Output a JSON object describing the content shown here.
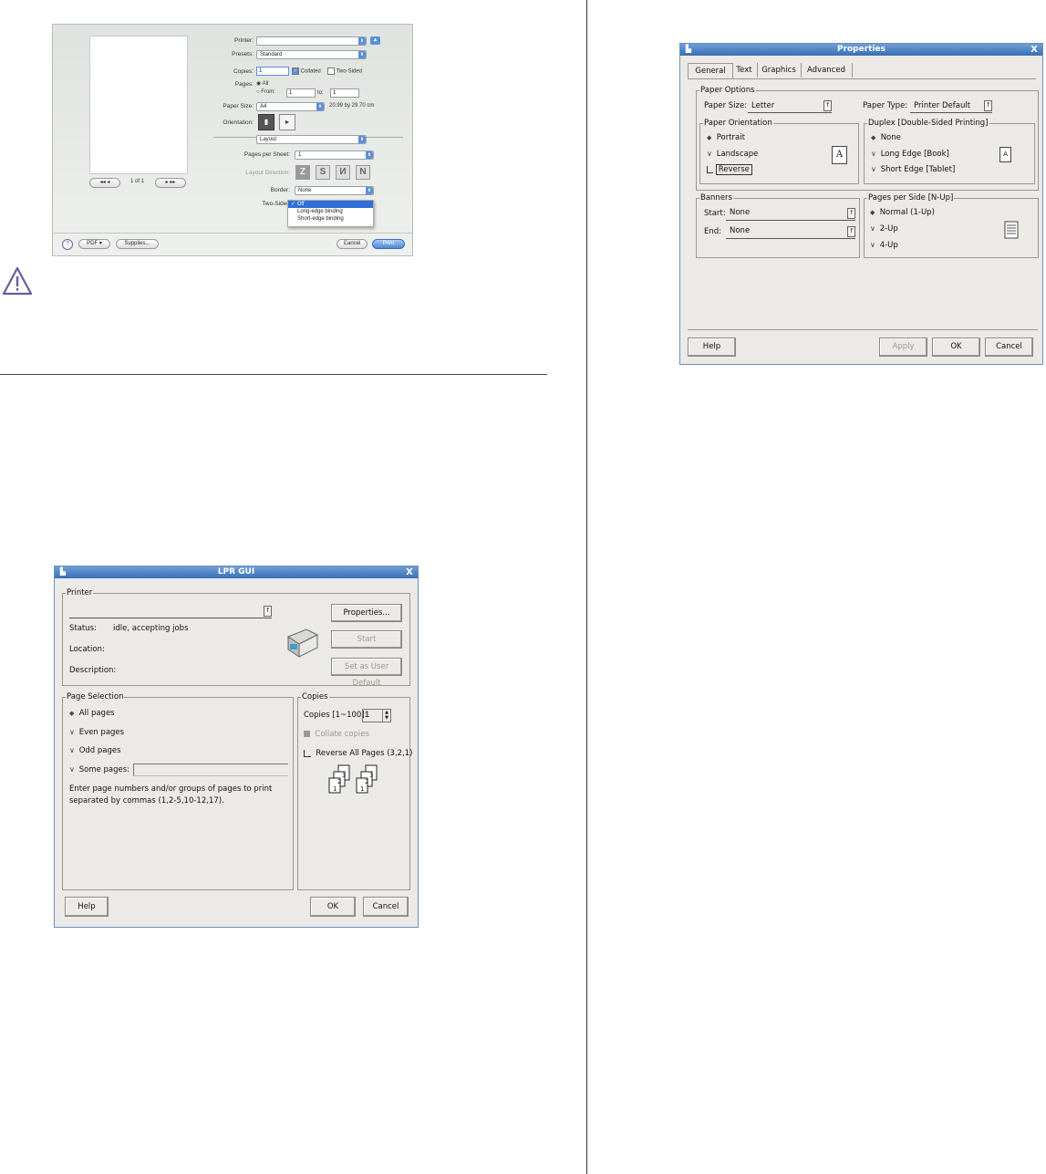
{
  "mac_dialog": {
    "printer_label": "Printer:",
    "presets_label": "Presets:",
    "presets_value": "Standard",
    "copies_label": "Copies:",
    "copies_value": "1",
    "collated_label": "Collated",
    "two_sided_label": "Two-Sided",
    "pages_label": "Pages:",
    "pages_all": "All",
    "pages_from": "From:",
    "pages_from_value": "1",
    "pages_to": "to:",
    "pages_to_value": "1",
    "paper_size_label": "Paper Size:",
    "paper_size_value": "A4",
    "paper_size_dims": "20.99 by 29.70 cm",
    "orientation_label": "Orientation:",
    "section_value": "Layout",
    "pages_per_sheet_label": "Pages per Sheet:",
    "pages_per_sheet_value": "1",
    "layout_direction_label": "Layout Direction:",
    "border_label": "Border:",
    "border_value": "None",
    "two_sided_field_label": "Two-Sided",
    "two_sided_menu": [
      "✓ Off",
      "Long-edge binding",
      "Short-edge binding"
    ],
    "page_indicator": "1 of 1",
    "help_glyph": "?",
    "pdf_button": "PDF ▾",
    "supplies_button": "Supplies...",
    "cancel_button": "Cancel",
    "print_button": "Print"
  },
  "lpr_gui": {
    "title": "LPR GUI",
    "close": "X",
    "printer_group": "Printer",
    "combo_glyph": "f",
    "properties_button": "Properties...",
    "status_label": "Status:",
    "status_value": "idle, accepting jobs",
    "location_label": "Location:",
    "description_label": "Description:",
    "start_button": "Start",
    "set_default_button": "Set as User Default",
    "page_selection_group": "Page Selection",
    "all_pages": "All pages",
    "even_pages": "Even pages",
    "odd_pages": "Odd pages",
    "some_pages": "Some pages:",
    "hint": "Enter page numbers and/or groups of pages to print separated by commas (1,2-5,10-12,17).",
    "copies_group": "Copies",
    "copies_label": "Copies [1~100]:",
    "copies_value": "1",
    "collate_copies": "Collate copies",
    "reverse_pages": "Reverse All Pages (3,2,1)",
    "help_button": "Help",
    "ok_button": "OK",
    "cancel_button": "Cancel"
  },
  "properties": {
    "title": "Properties",
    "close": "X",
    "tabs": [
      "General",
      "Text",
      "Graphics",
      "Advanced"
    ],
    "combo_glyph": "f",
    "paper_options_group": "Paper Options",
    "paper_size_label": "Paper Size:",
    "paper_size_value": "Letter",
    "paper_type_label": "Paper Type:",
    "paper_type_value": "Printer Default",
    "orientation_group": "Paper Orientation",
    "portrait": "Portrait",
    "landscape": "Landscape",
    "reverse": "Reverse",
    "page_glyph": "A",
    "duplex_group": "Duplex [Double-Sided Printing]",
    "duplex_none": "None",
    "duplex_long": "Long Edge [Book]",
    "duplex_short": "Short Edge [Tablet]",
    "banners_group": "Banners",
    "start_label": "Start:",
    "start_value": "None",
    "end_label": "End:",
    "end_value": "None",
    "nup_group": "Pages per Side [N-Up]",
    "nup_normal": "Normal (1-Up)",
    "nup_2": "2-Up",
    "nup_4": "4-Up",
    "help_button": "Help",
    "apply_button": "Apply",
    "ok_button": "OK",
    "cancel_button": "Cancel"
  }
}
